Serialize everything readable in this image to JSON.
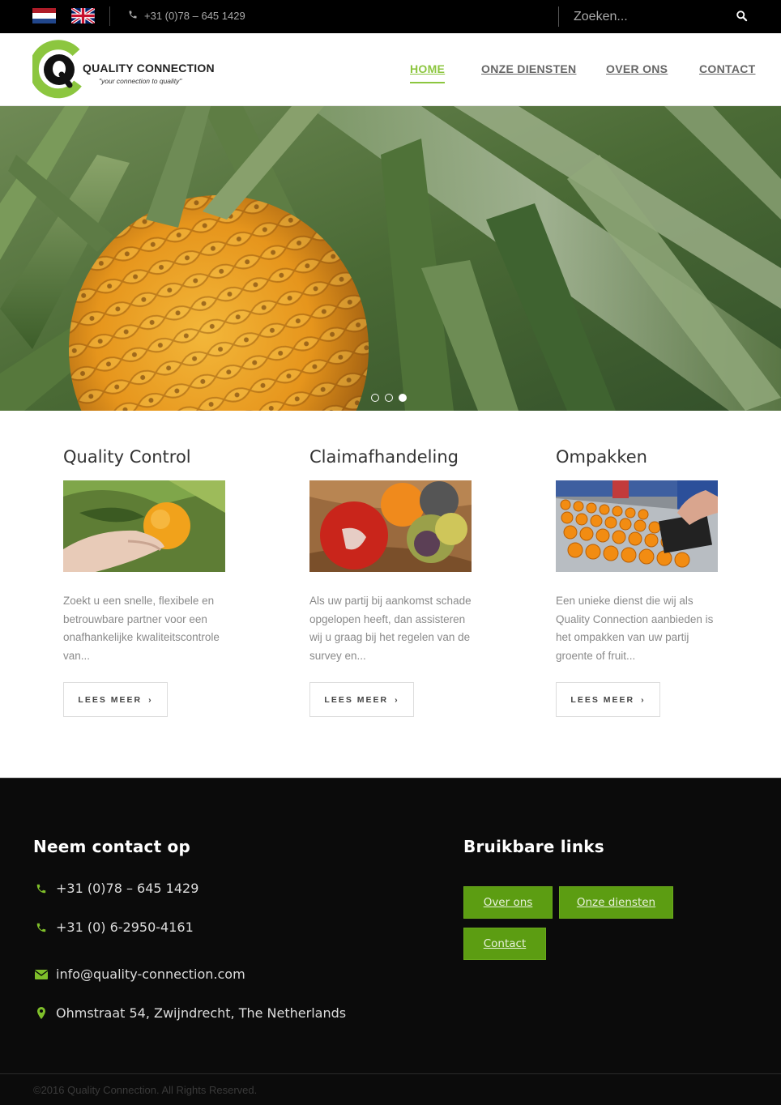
{
  "topbar": {
    "flags": [
      "dutch-flag",
      "uk-flag"
    ],
    "phone": "+31 (0)78 – 645 1429",
    "search_placeholder": "Zoeken..."
  },
  "logo": {
    "name": "QUALITY CONNECTION",
    "tagline": "\"your connection to quality\""
  },
  "nav": {
    "items": [
      {
        "label": "HOME",
        "active": true
      },
      {
        "label": "ONZE DIENSTEN",
        "active": false
      },
      {
        "label": "OVER ONS",
        "active": false
      },
      {
        "label": "CONTACT",
        "active": false
      }
    ]
  },
  "hero": {
    "image": "pineapple-plant-photo",
    "slides": 3,
    "active_slide": 3
  },
  "services": [
    {
      "title": "Quality Control",
      "image": "orange-in-hand-photo",
      "text": "Zoekt u een snelle, flexibele en betrouwbare partner voor een onafhankelijke kwaliteitscontrole van...",
      "button": "LEES MEER"
    },
    {
      "title": "Claimafhandeling",
      "image": "rotten-fruit-photo",
      "text": "Als uw partij bij aankomst schade opgelopen heeft, dan assisteren wij u graag bij het regelen van de survey en...",
      "button": "LEES MEER"
    },
    {
      "title": "Ompakken",
      "image": "oranges-on-conveyor-photo",
      "text": "Een unieke dienst die wij als Quality Connection aanbieden is het ompakken van uw partij groente of fruit...",
      "button": "LEES MEER"
    }
  ],
  "footer": {
    "contact_title": "Neem contact op",
    "contact": [
      {
        "icon": "phone-icon",
        "text": "+31 (0)78 – 645 1429"
      },
      {
        "icon": "phone-icon",
        "text": "+31 (0) 6-2950-4161"
      },
      {
        "icon": "envelope-icon",
        "text": "info@quality-connection.com"
      },
      {
        "icon": "map-marker-icon",
        "text": "Ohmstraat 54, Zwijndrecht, The Netherlands"
      }
    ],
    "links_title": "Bruikbare links",
    "links": [
      "Over ons",
      "Onze diensten",
      "Contact"
    ],
    "copyright": "©2016 Quality Connection. All Rights Reserved."
  },
  "colors": {
    "accent": "#8cc63f",
    "button_green": "#5c9d12",
    "topbar": "#000000",
    "footer": "#0b0b0b"
  }
}
